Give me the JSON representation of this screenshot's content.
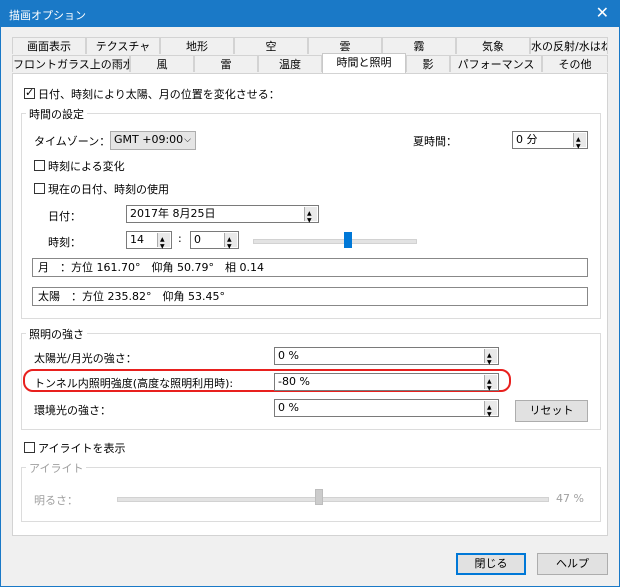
{
  "window": {
    "title": "描画オプション",
    "close": "✕"
  },
  "tabs_row1": [
    "画面表示",
    "テクスチャ",
    "地形",
    "空",
    "雲",
    "霧",
    "気象",
    "水の反射/水はね"
  ],
  "tabs_row2": [
    "フロントガラス上の雨水",
    "風",
    "雷",
    "温度",
    "時間と照明",
    "影",
    "パフォーマンス",
    "その他"
  ],
  "main": {
    "use_datetime_checkbox": {
      "label": "日付、時刻により太陽、月の位置を変化させる：",
      "checked": true
    },
    "time_settings": {
      "legend": "時間の設定",
      "timezone_label": "タイムゾーン：",
      "timezone_value": "GMT +09:00",
      "dst_label": "夏時間：",
      "dst_value": "0 分",
      "change_by_time": {
        "label": "時刻による変化",
        "checked": false
      },
      "use_current": {
        "label": "現在の日付、時刻の使用",
        "checked": false
      },
      "date_label": "日付：",
      "date_value": "2017年  8月25日",
      "time_label": "時刻：",
      "hour_value": "14",
      "sep": ":",
      "minute_value": "0",
      "time_slider_fraction": 0.587,
      "moon_info": "月　：方位 161.70°　仰角 50.79°　相 0.14",
      "sun_info": "太陽　：方位 235.82°　仰角 53.45°"
    },
    "lighting": {
      "legend": "照明の強さ",
      "sun_moon_label": "太陽光/月光の強さ：",
      "sun_moon_value": "0 %",
      "tunnel_label": "トンネル内照明強度(高度な照明利用時):",
      "tunnel_value": "-80 %",
      "ambient_label": "環境光の強さ：",
      "ambient_value": "0 %",
      "reset_button": "リセット"
    },
    "eyelight_checkbox": {
      "label": "アイライトを表示",
      "checked": false
    },
    "eyelight": {
      "legend": "アイライト",
      "brightness_label": "明るさ：",
      "brightness_value": "47 %",
      "brightness_fraction": 0.47
    }
  },
  "footer": {
    "close_button": "閉じる",
    "help_button": "ヘルプ"
  },
  "colors": {
    "titlebar": "#1a79c7",
    "highlight": "#e8201e",
    "slider_thumb": "#0078d7"
  }
}
